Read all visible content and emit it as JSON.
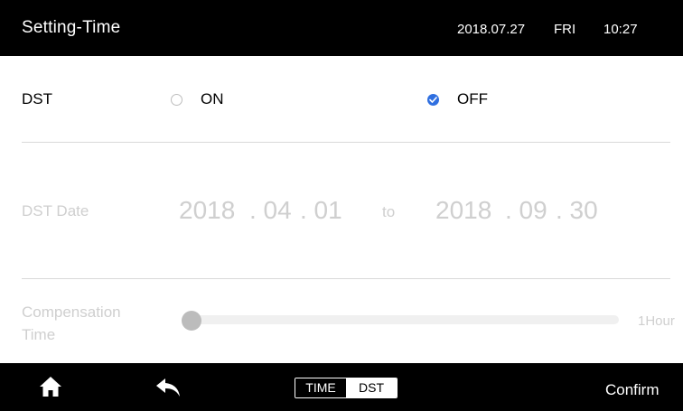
{
  "header": {
    "title": "Setting-Time",
    "date": "2018.07.27",
    "day": "FRI",
    "time": "10:27"
  },
  "dst": {
    "label": "DST",
    "options": [
      {
        "label": "ON",
        "selected": false
      },
      {
        "label": "OFF",
        "selected": true
      }
    ]
  },
  "dst_date": {
    "label": "DST Date",
    "start": {
      "year": "2018",
      "month": ". 04",
      "day": ". 01"
    },
    "connector": "to",
    "end": {
      "year": "2018",
      "month": ". 09",
      "day": ". 30"
    }
  },
  "compensation": {
    "label_line1": "Compensation",
    "label_line2": "Time",
    "max_label": "1Hour",
    "value_fraction": 0.0
  },
  "footer": {
    "home_icon": "home-icon",
    "back_icon": "back-arrow-icon",
    "tabs": [
      {
        "label": "TIME",
        "active": false
      },
      {
        "label": "DST",
        "active": true
      }
    ],
    "confirm_label": "Confirm"
  },
  "colors": {
    "bar_background": "#000000",
    "accent": "#2f6fe0",
    "disabled_text": "#cfcfcf"
  }
}
